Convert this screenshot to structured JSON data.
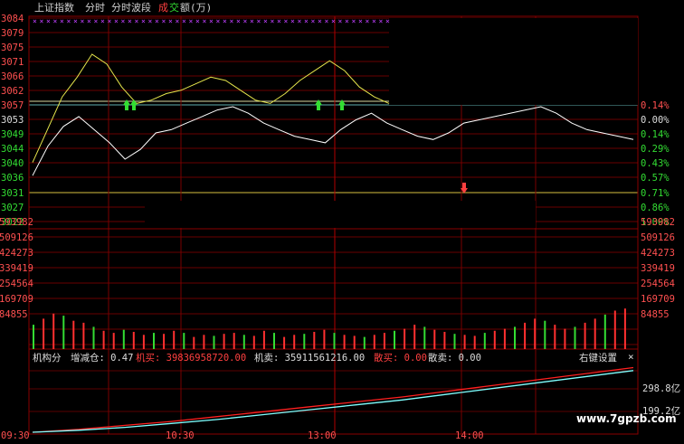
{
  "header": {
    "index_name": "上证指数",
    "tab_minute": "分时",
    "tab_wave": "分时波段",
    "vol_label_1": "成",
    "vol_label_2": "交",
    "vol_label_3": "额(万)"
  },
  "price_axis": [
    "3084",
    "3079",
    "3075",
    "3071",
    "3066",
    "3062",
    "3057",
    "3053",
    "3049",
    "3044",
    "3040",
    "3036",
    "3031",
    "3027",
    "3022"
  ],
  "pct_axis": [
    "0.14%",
    "0.00%",
    "0.14%",
    "0.29%",
    "0.43%",
    "0.57%",
    "0.71%",
    "0.86%",
    "1.00%"
  ],
  "volume_axis": [
    "593982",
    "509126",
    "424273",
    "339419",
    "254564",
    "169709",
    "84855"
  ],
  "indicator": {
    "name": "机构分",
    "change_label": "增减仓: 0.47",
    "buy_label": "机买: 39836958720.00",
    "sell_label": "机卖: 35911561216.00",
    "retail_buy_label": "散买: 0.00",
    "retail_sell_label": "散卖: 0.00",
    "right_click": "右键设置",
    "close": "×"
  },
  "lower_axis": [
    "298.8亿",
    "199.2亿"
  ],
  "time_axis": [
    "09:30",
    "10:30",
    "13:00",
    "14:00"
  ],
  "watermark": "www.7gpzb.com",
  "colors": {
    "price_up": "#ff4040",
    "price_down": "#33dd33",
    "yellow": "#e6e64c",
    "white": "#ffffff",
    "red_grid": "#8a0000",
    "cyan": "#7fffff"
  },
  "chart_data": {
    "type": "line",
    "title": "上证指数 分时",
    "x_labels": [
      "09:30",
      "10:30",
      "13:00",
      "14:00"
    ],
    "ylim": [
      3022,
      3084
    ],
    "series": [
      {
        "name": "price",
        "color": "white",
        "values": [
          3036,
          3045,
          3051,
          3054,
          3050,
          3046,
          3041,
          3044,
          3049,
          3050,
          3052,
          3054,
          3056,
          3057,
          3055,
          3052,
          3050,
          3048,
          3047,
          3046,
          3050,
          3053,
          3055,
          3052,
          3050,
          3048,
          3047,
          3049,
          3052,
          3053,
          3054,
          3055,
          3056,
          3057,
          3055,
          3052,
          3050,
          3049,
          3048,
          3047
        ]
      },
      {
        "name": "wave",
        "color": "yellow",
        "values": [
          3040,
          3050,
          3060,
          3066,
          3073,
          3070,
          3063,
          3058,
          3059,
          3061,
          3062,
          3064,
          3066,
          3065,
          3062,
          3059,
          3058,
          3061,
          3065,
          3068,
          3071,
          3068,
          3063,
          3060,
          3058
        ]
      }
    ],
    "volume": {
      "values": [
        120000,
        150000,
        175000,
        165000,
        140000,
        130000,
        110000,
        90000,
        80000,
        95000,
        85000,
        70000,
        80000,
        75000,
        90000,
        80000,
        60000,
        70000,
        65000,
        75000,
        80000,
        70000,
        65000,
        90000,
        80000,
        60000,
        70000,
        75000,
        85000,
        95000,
        80000,
        70000,
        65000,
        60000,
        70000,
        80000,
        90000,
        100000,
        120000,
        110000,
        95000,
        85000,
        75000,
        70000,
        65000,
        80000,
        90000,
        100000,
        110000,
        130000,
        150000,
        140000,
        120000,
        100000,
        110000,
        130000,
        150000,
        170000,
        190000,
        200000
      ]
    },
    "lower": {
      "series": [
        {
          "name": "机买",
          "color": "red",
          "values": [
            0,
            15,
            35,
            55,
            80,
            105,
            130,
            155,
            180,
            210,
            240,
            270,
            300,
            330
          ]
        },
        {
          "name": "机卖",
          "color": "cyan",
          "values": [
            0,
            10,
            25,
            45,
            65,
            90,
            115,
            140,
            165,
            195,
            225,
            255,
            285,
            315
          ]
        }
      ]
    }
  }
}
